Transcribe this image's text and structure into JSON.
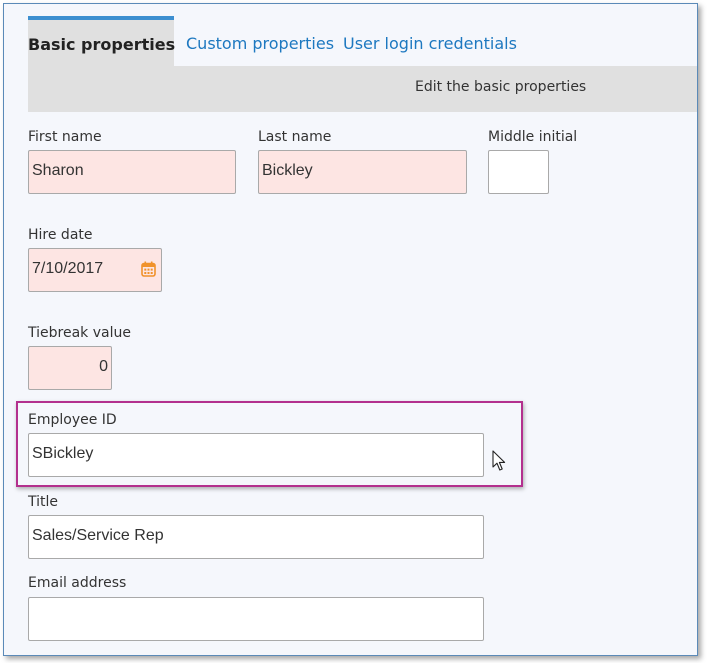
{
  "tabs": [
    {
      "label": "Basic properties",
      "active": true
    },
    {
      "label": "Custom properties",
      "active": false
    },
    {
      "label": "User login credentials",
      "active": false
    }
  ],
  "subheader": "Edit the basic properties",
  "fields": {
    "first_name": {
      "label": "First name",
      "value": "Sharon"
    },
    "last_name": {
      "label": "Last name",
      "value": "Bickley"
    },
    "middle_initial": {
      "label": "Middle initial",
      "value": ""
    },
    "hire_date": {
      "label": "Hire date",
      "value": "7/10/2017",
      "icon": "calendar-icon"
    },
    "tiebreak": {
      "label": "Tiebreak value",
      "value": "0"
    },
    "employee_id": {
      "label": "Employee ID",
      "value": "SBickley"
    },
    "title": {
      "label": "Title",
      "value": "Sales/Service Rep"
    },
    "email": {
      "label": "Email address",
      "value": ""
    }
  },
  "colors": {
    "accent": "#1d78c0",
    "required_bg": "#fde5e3",
    "highlight": "#b3308e",
    "calendar_icon": "#f0922b"
  }
}
